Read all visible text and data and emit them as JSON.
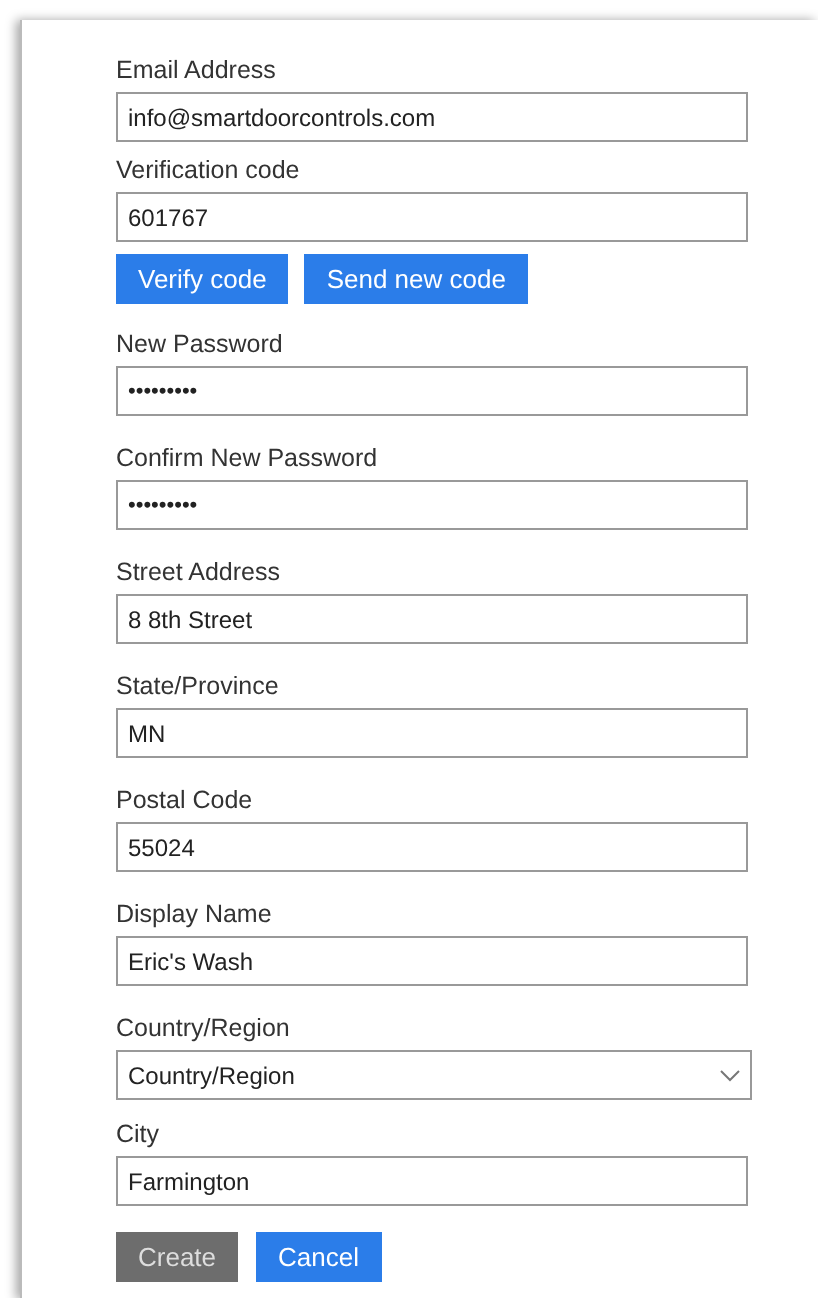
{
  "verification": [
    {
      "kind": "text",
      "label": "Email Address",
      "value": "info@smartdoorcontrols.com"
    },
    {
      "kind": "text",
      "label": "Verification code",
      "value": "601767"
    }
  ],
  "verification_buttons": [
    {
      "label": "Verify code",
      "disabled": false
    },
    {
      "label": "Send new code",
      "disabled": false
    }
  ],
  "fields": [
    {
      "kind": "password",
      "label": "New Password",
      "value": "•••••••••"
    },
    {
      "kind": "password",
      "label": "Confirm New Password",
      "value": "•••••••••"
    },
    {
      "kind": "text",
      "label": "Street Address",
      "value": "8 8th Street"
    },
    {
      "kind": "text",
      "label": "State/Province",
      "value": "MN"
    },
    {
      "kind": "text",
      "label": "Postal Code",
      "value": "55024"
    },
    {
      "kind": "text",
      "label": "Display Name",
      "value": "Eric's Wash"
    },
    {
      "kind": "select",
      "label": "Country/Region",
      "value": "Country/Region"
    },
    {
      "kind": "text",
      "label": "City",
      "value": "Farmington"
    }
  ],
  "actions": [
    {
      "label": "Create",
      "disabled": true
    },
    {
      "label": "Cancel",
      "disabled": false
    }
  ]
}
